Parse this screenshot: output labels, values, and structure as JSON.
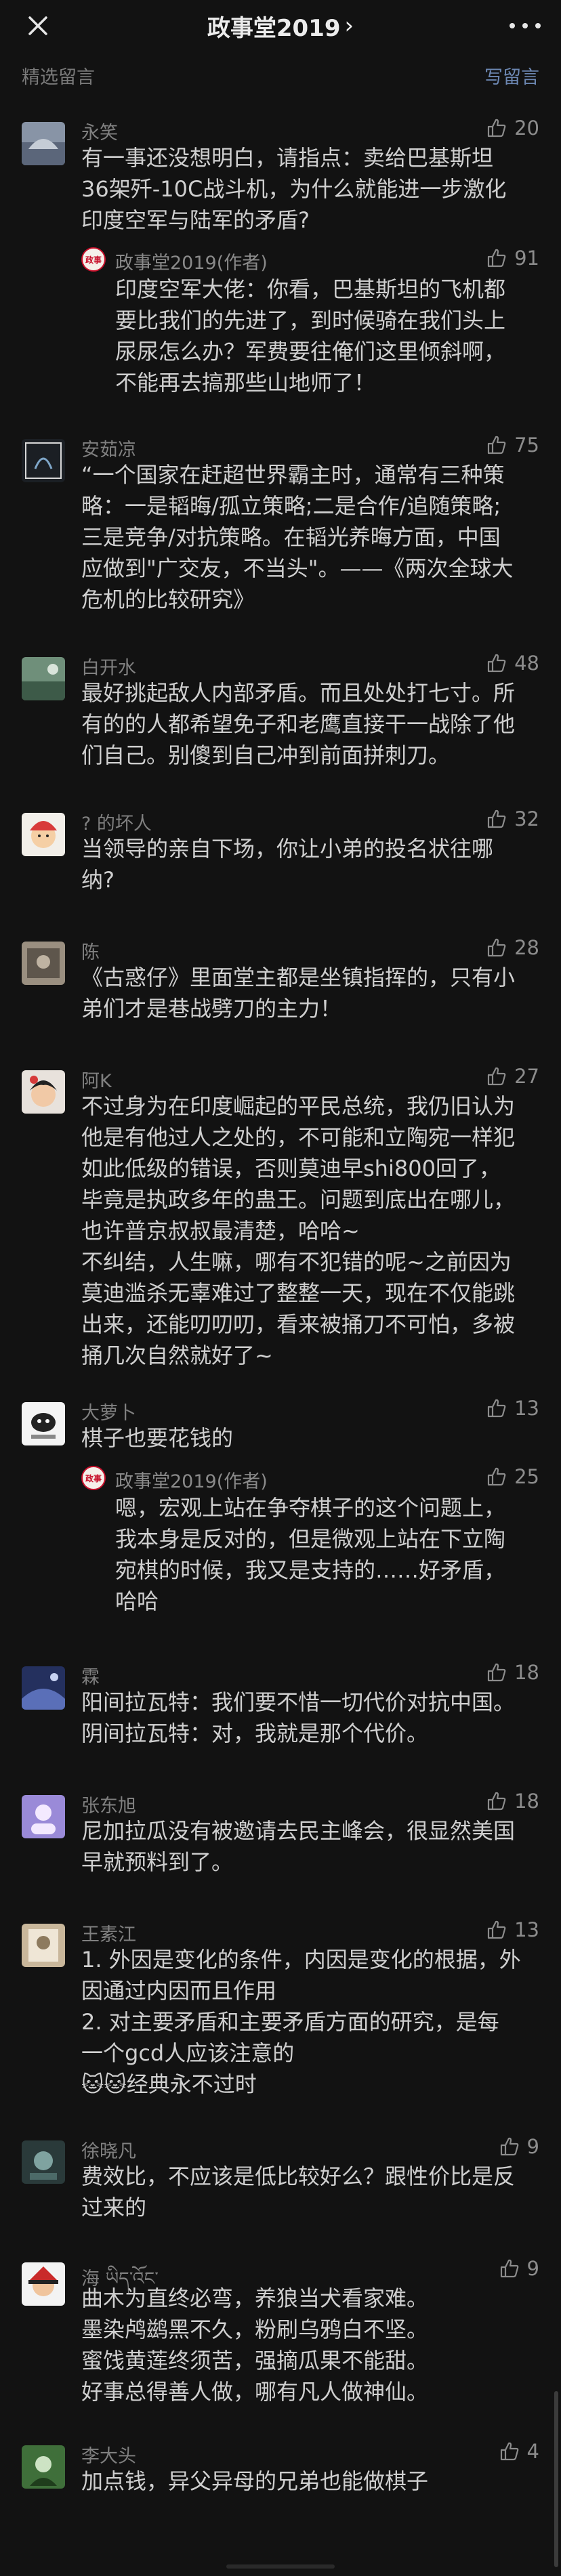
{
  "nav": {
    "title": "政事堂2019",
    "chevron": "›"
  },
  "subheader": {
    "label": "精选留言",
    "write": "写留言"
  },
  "colors": {
    "background": "#121212",
    "link": "#6c87b2",
    "reply_badge": "#c7102b"
  },
  "comments": [
    {
      "name": "永笑",
      "likes": "20",
      "text": "有一事还没想明白，请指点：卖给巴基斯坦\n36架歼-10C战斗机，为什么就能进一步激化\n印度空军与陆军的矛盾?",
      "reply": {
        "name": "政事堂2019(作者)",
        "likes": "91",
        "text": "印度空军大佬：你看，巴基斯坦的飞机都\n要比我们的先进了，到时候骑在我们头上\n尿尿怎么办？军费要往俺们这里倾斜啊，\n不能再去搞那些山地师了！"
      }
    },
    {
      "name": "安茹凉",
      "likes": "75",
      "text": "“一个国家在赶超世界霸主时，通常有三种策\n略：一是韬晦/孤立策略;二是合作/追随策略;\n三是竞争/对抗策略。在韬光养晦方面，中国\n应做到\"广交友，不当头\"。——《两次全球大\n危机的比较研究》"
    },
    {
      "name": "白开水",
      "likes": "48",
      "text": "最好挑起敌人内部矛盾。而且处处打七寸。所\n有的的人都希望免子和老鹰直接干一战除了他\n们自己。别傻到自己冲到前面拼刺刀。"
    },
    {
      "name": "? 的坏人",
      "likes": "32",
      "text": "当领导的亲自下场，你让小弟的投名状往哪\n纳?"
    },
    {
      "name": "陈",
      "likes": "28",
      "text": "《古惑仔》里面堂主都是坐镇指挥的，只有小\n弟们才是巷战劈刀的主力！"
    },
    {
      "name": "阿K",
      "likes": "27",
      "text": "不过身为在印度崛起的平民总统，我仍旧认为\n他是有他过人之处的，不可能和立陶宛一样犯\n如此低级的错误，否则莫迪早shi800回了，\n毕竟是执政多年的蛊王。问题到底出在哪儿，\n也许普京叔叔最清楚，哈哈~\n不纠结，人生嘛，哪有不犯错的呢~之前因为\n莫迪滥杀无辜难过了整整一天，现在不仅能跳\n出来，还能叨叨叨，看来被捅刀不可怕，多被\n捅几次自然就好了~"
    },
    {
      "name": "大萝卜",
      "likes": "13",
      "text": "棋子也要花钱的",
      "reply": {
        "name": "政事堂2019(作者)",
        "likes": "25",
        "text": "嗯，宏观上站在争夺棋子的这个问题上，\n我本身是反对的，但是微观上站在下立陶\n宛棋的时候，我又是支持的……好矛盾，\n哈哈"
      }
    },
    {
      "name": "霖",
      "likes": "18",
      "text": "阳间拉瓦特：我们要不惜一切代价对抗中国。\n阴间拉瓦特：对，我就是那个代价。"
    },
    {
      "name": "张东旭",
      "likes": "18",
      "text": "尼加拉瓜没有被邀请去民主峰会，很显然美国\n早就预料到了。"
    },
    {
      "name": "王素江",
      "likes": "13",
      "text": "1. 外因是变化的条件，内因是变化的根据，外\n因通过内因而且作用\n2. 对主要矛盾和主要矛盾方面的研究，是每\n一个gcd人应该注意的\n🐱🐱经典永不过时"
    },
    {
      "name": "徐晓凡",
      "likes": "9",
      "text": "费效比，不应该是低比较好么？跟性价比是反\n过来的"
    },
    {
      "name": "海 ཡིད་འོང་",
      "likes": "9",
      "text": "曲木为直终必弯，养狼当犬看家难。\n墨染鸬鹚黑不久，粉刷乌鸦白不坚。\n蜜饯黄莲终须苦，强摘瓜果不能甜。\n好事总得善人做，哪有凡人做神仙。"
    },
    {
      "name": "李大头",
      "likes": "4",
      "text": "加点钱，异父异母的兄弟也能做棋子"
    }
  ]
}
